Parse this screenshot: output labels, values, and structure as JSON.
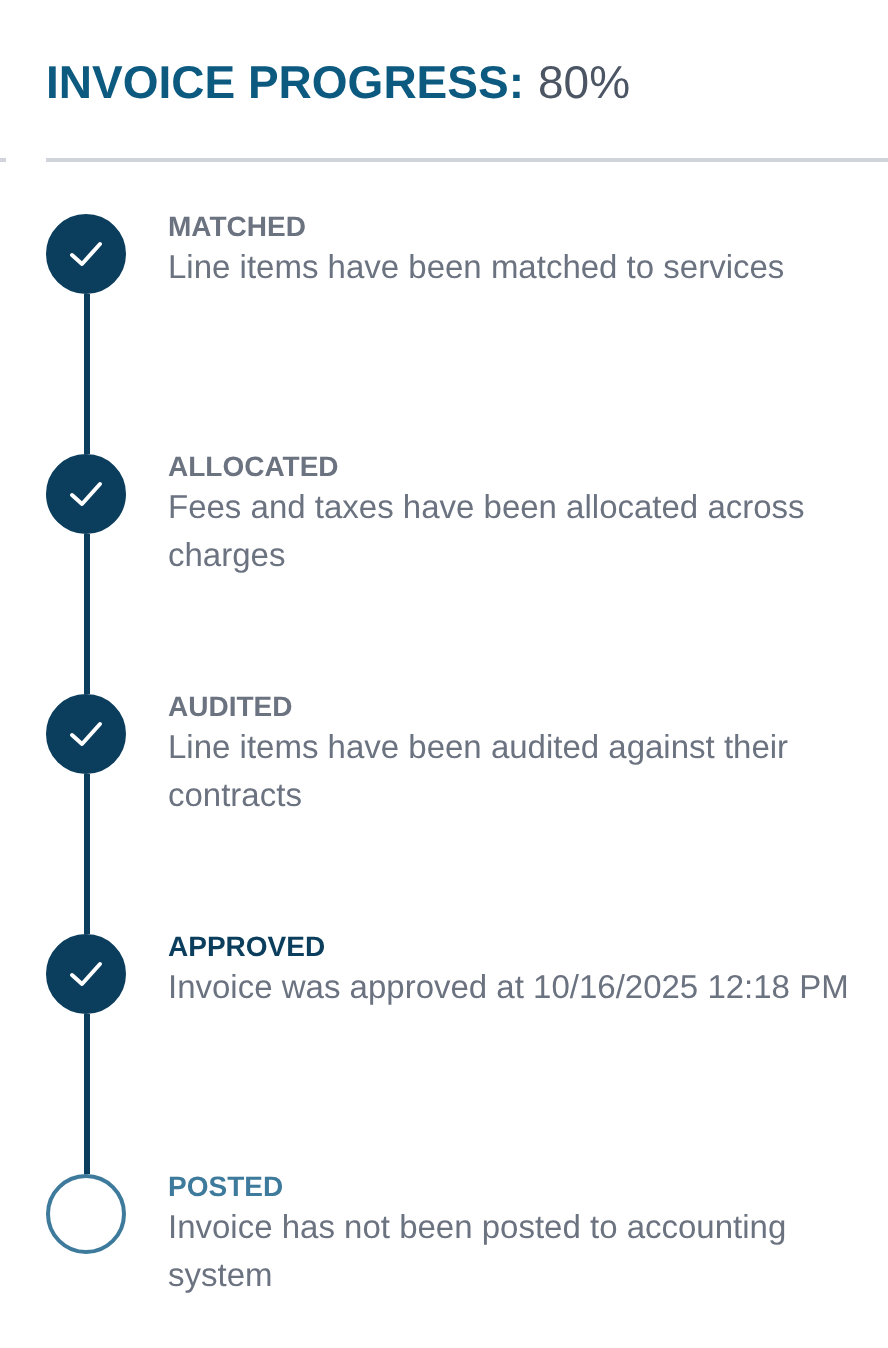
{
  "header": {
    "title": "INVOICE PROGRESS:",
    "value": "80%"
  },
  "steps": [
    {
      "label": "MATCHED",
      "description": "Line items have been matched to services",
      "completed": true,
      "selected": false
    },
    {
      "label": "ALLOCATED",
      "description": "Fees and taxes have been allocated across charges",
      "completed": true,
      "selected": false
    },
    {
      "label": "AUDITED",
      "description": "Line items have been audited against their contracts",
      "completed": true,
      "selected": false
    },
    {
      "label": "APPROVED",
      "description": "Invoice was approved at 10/16/2025 12:18 PM",
      "completed": true,
      "selected": true
    },
    {
      "label": "POSTED",
      "description": "Invoice has not been posted to accounting system",
      "completed": false,
      "selected": false
    }
  ]
}
